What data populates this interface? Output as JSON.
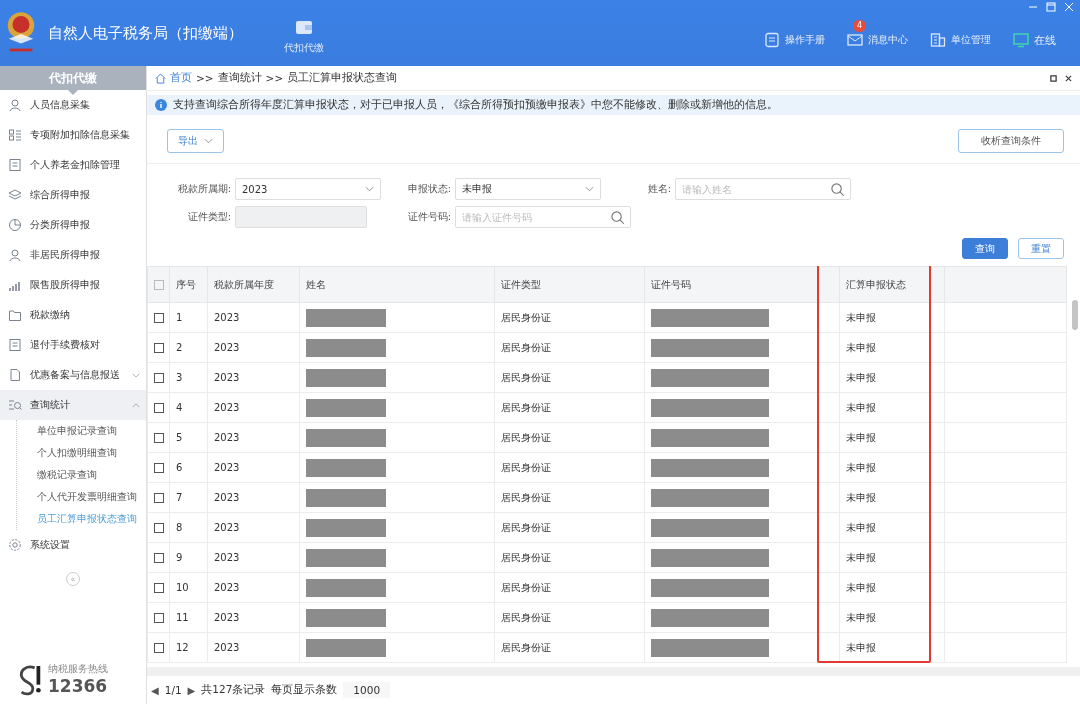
{
  "app": {
    "title": "自然人电子税务局（扣缴端）",
    "module": "代扣代缴"
  },
  "header_links": [
    {
      "label": "操作手册",
      "kind": "manual"
    },
    {
      "label": "消息中心",
      "kind": "message",
      "badge": "4"
    },
    {
      "label": "单位管理",
      "kind": "unit"
    },
    {
      "label": "在线",
      "kind": "online"
    }
  ],
  "sidebar": {
    "title": "代扣代缴",
    "items": [
      {
        "label": "人员信息采集"
      },
      {
        "label": "专项附加扣除信息采集"
      },
      {
        "label": "个人养老金扣除管理"
      },
      {
        "label": "综合所得申报"
      },
      {
        "label": "分类所得申报"
      },
      {
        "label": "非居民所得申报"
      },
      {
        "label": "限售股所得申报"
      },
      {
        "label": "税款缴纳"
      },
      {
        "label": "退付手续费核对"
      },
      {
        "label": "优惠备案与信息报送",
        "expanded": false
      },
      {
        "label": "查询统计",
        "expanded": true,
        "children": [
          {
            "label": "单位申报记录查询",
            "selected": false
          },
          {
            "label": "个人扣缴明细查询",
            "selected": false
          },
          {
            "label": "缴税记录查询",
            "selected": false
          },
          {
            "label": "个人代开发票明细查询",
            "selected": false
          },
          {
            "label": "员工汇算申报状态查询",
            "selected": true
          }
        ]
      },
      {
        "label": "系统设置"
      }
    ],
    "collapse_glyph": "«",
    "hotline_label": "纳税服务热线",
    "hotline": "12366"
  },
  "breadcrumb": [
    "首页",
    ">>",
    "查询统计",
    ">>",
    "员工汇算申报状态查询"
  ],
  "notice": "支持查询综合所得年度汇算申报状态，对于已申报人员，《综合所得预扣预缴申报表》中您不能修改、删除或新增他的信息。",
  "export_button": "导出",
  "collapse_button": "收析查询条件",
  "filters": [
    {
      "label": "税款所属期:",
      "kind": "select",
      "value": "2023"
    },
    {
      "label": "申报状态:",
      "kind": "select",
      "value": "未申报"
    },
    {
      "label": "姓名:",
      "kind": "search",
      "placeholder": "请输入姓名"
    },
    {
      "label": "证件类型:",
      "kind": "disabled"
    },
    {
      "label": "证件号码:",
      "kind": "search",
      "placeholder": "请输入证件号码"
    }
  ],
  "query_button": "查询",
  "reset_button": "重置",
  "table": {
    "all_checked": false,
    "columns": [
      "序号",
      "税款所属年度",
      "姓名",
      "证件类型",
      "证件号码",
      "汇算申报状态"
    ],
    "rows": [
      {
        "no": "1",
        "year": "2023",
        "id_type": "居民身份证",
        "status": "未申报",
        "checked": false
      },
      {
        "no": "2",
        "year": "2023",
        "id_type": "居民身份证",
        "status": "未申报",
        "checked": false
      },
      {
        "no": "3",
        "year": "2023",
        "id_type": "居民身份证",
        "status": "未申报",
        "checked": false
      },
      {
        "no": "4",
        "year": "2023",
        "id_type": "居民身份证",
        "status": "未申报",
        "checked": false
      },
      {
        "no": "5",
        "year": "2023",
        "id_type": "居民身份证",
        "status": "未申报",
        "checked": false
      },
      {
        "no": "6",
        "year": "2023",
        "id_type": "居民身份证",
        "status": "未申报",
        "checked": false
      },
      {
        "no": "7",
        "year": "2023",
        "id_type": "居民身份证",
        "status": "未申报",
        "checked": false
      },
      {
        "no": "8",
        "year": "2023",
        "id_type": "居民身份证",
        "status": "未申报",
        "checked": false
      },
      {
        "no": "9",
        "year": "2023",
        "id_type": "居民身份证",
        "status": "未申报",
        "checked": false
      },
      {
        "no": "10",
        "year": "2023",
        "id_type": "居民身份证",
        "status": "未申报",
        "checked": false
      },
      {
        "no": "11",
        "year": "2023",
        "id_type": "居民身份证",
        "status": "未申报",
        "checked": false
      },
      {
        "no": "12",
        "year": "2023",
        "id_type": "居民身份证",
        "status": "未申报",
        "checked": false
      }
    ]
  },
  "pager": {
    "prev": "◀",
    "pages": "1/1",
    "next": "▶",
    "total": "共127条记录",
    "page_size_label": "每页显示条数",
    "page_size": "1000"
  }
}
